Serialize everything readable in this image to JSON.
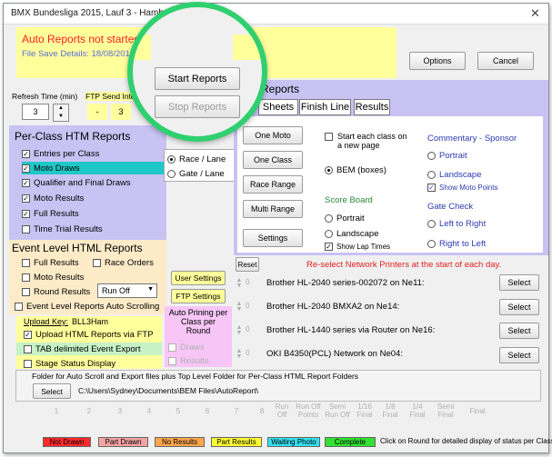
{
  "window": {
    "title": "BMX Bundesliga 2015, Lauf 3 - Hamburg",
    "close_glyph": "✕"
  },
  "status": {
    "auto_reports": "Auto Reports not started",
    "file_save": "File Save Details:  18/08/2015"
  },
  "top_buttons": {
    "options": "Options",
    "cancel": "Cancel",
    "start": "Start Reports",
    "stop": "Stop Reports"
  },
  "refresh": {
    "label": "Refresh Time (min)",
    "value": "3"
  },
  "ftp_send": {
    "label": "FTP Send Inter",
    "value1": "-",
    "value2": "3"
  },
  "per_class": {
    "title": "Per-Class HTM Reports",
    "items": [
      {
        "label": "Entries per Class",
        "checked": true
      },
      {
        "label": "Moto Draws",
        "checked": true
      },
      {
        "label": "Qualifier and Final Draws",
        "checked": true
      },
      {
        "label": "Moto Results",
        "checked": true
      },
      {
        "label": "Full Results",
        "checked": true
      },
      {
        "label": "Time Trial Results",
        "checked": false
      }
    ]
  },
  "lane": {
    "race_lane": "Race / Lane",
    "gate_lane": "Gate / Lane"
  },
  "event_level": {
    "title": "Event Level HTML Reports",
    "full_results": "Full Results",
    "race_orders": "Race Orders",
    "moto_results": "Moto Results",
    "round_results": "Round Results",
    "round_select": "Run Off",
    "auto_scrolling": "Event Level Reports Auto Scrolling"
  },
  "upload": {
    "key_label": "Upload Key:",
    "key_value": "BLL3Ham",
    "upload_ftp": "Upload HTML Reports via FTP",
    "tab_delimited": "TAB delimited Event Export",
    "stage_status": "Stage Status Display"
  },
  "settings_buttons": {
    "user": "User Settings",
    "ftp": "FTP Settings"
  },
  "auto_printing": {
    "label": "Auto Prining per Class per Round",
    "draws": "Draws",
    "results": "Results"
  },
  "print_reports": {
    "title": "Reports",
    "tabs": [
      "Sheets",
      "Finish Line",
      "Results"
    ],
    "buttons": [
      "One Moto",
      "One Class",
      "Race Range",
      "Multi Range",
      "Settings"
    ],
    "start_each_class": "Start each class on a new page",
    "bem_boxes": "BEM (boxes)",
    "score_board": {
      "title": "Score Board",
      "portrait": "Portrait",
      "landscape": "Landscape",
      "show_lap_times": "Show Lap Times"
    },
    "commentary": {
      "title": "Commentary - Sponsor",
      "portrait": "Portrait",
      "landscape": "Landscape",
      "show_moto_points": "Show Moto Points"
    },
    "gate_check": {
      "title": "Gate Check",
      "left_to_right": "Left to Right",
      "right_to_left": "Right to Left"
    }
  },
  "printers": {
    "reset": "Reset",
    "notice": "Re-select Network Printers at the start of each day.",
    "select_label": "Select",
    "spin_value": "0",
    "list": [
      "Brother HL-2040 series-002072 on Ne11:",
      "Brother HL-2040 BMXA2 on Ne14:",
      "Brother HL-1440 series via Router on Ne16:",
      "OKI B4350(PCL) Network on Ne04:"
    ]
  },
  "folder": {
    "label": "Folder for Auto Scroll and Export files plus Top Level Folder for Per-Class HTML Report Folders",
    "select": "Select",
    "path": "C:\\Users\\Sydney\\Documents\\BEM Files\\AutoReport\\"
  },
  "rounds": [
    "1",
    "2",
    "3",
    "4",
    "5",
    "6",
    "7",
    "8",
    "Run Off",
    "Run Off Points",
    "Semi Run Off",
    "1/16 Final",
    "1/8 Final",
    "1/4 Final",
    "Semi Final",
    "Final"
  ],
  "legend": [
    {
      "label": "Not Drawn",
      "color": "#ff2a2a"
    },
    {
      "label": "Part Drawn",
      "color": "#f4a3a3"
    },
    {
      "label": "No Results",
      "color": "#ffa64d"
    },
    {
      "label": "Part Results",
      "color": "#ffff33"
    },
    {
      "label": "Waiting Photo",
      "color": "#33e0f0"
    },
    {
      "label": "Complete",
      "color": "#33e033"
    }
  ],
  "legend_note": "Click on Round for detailed display of status per Class"
}
